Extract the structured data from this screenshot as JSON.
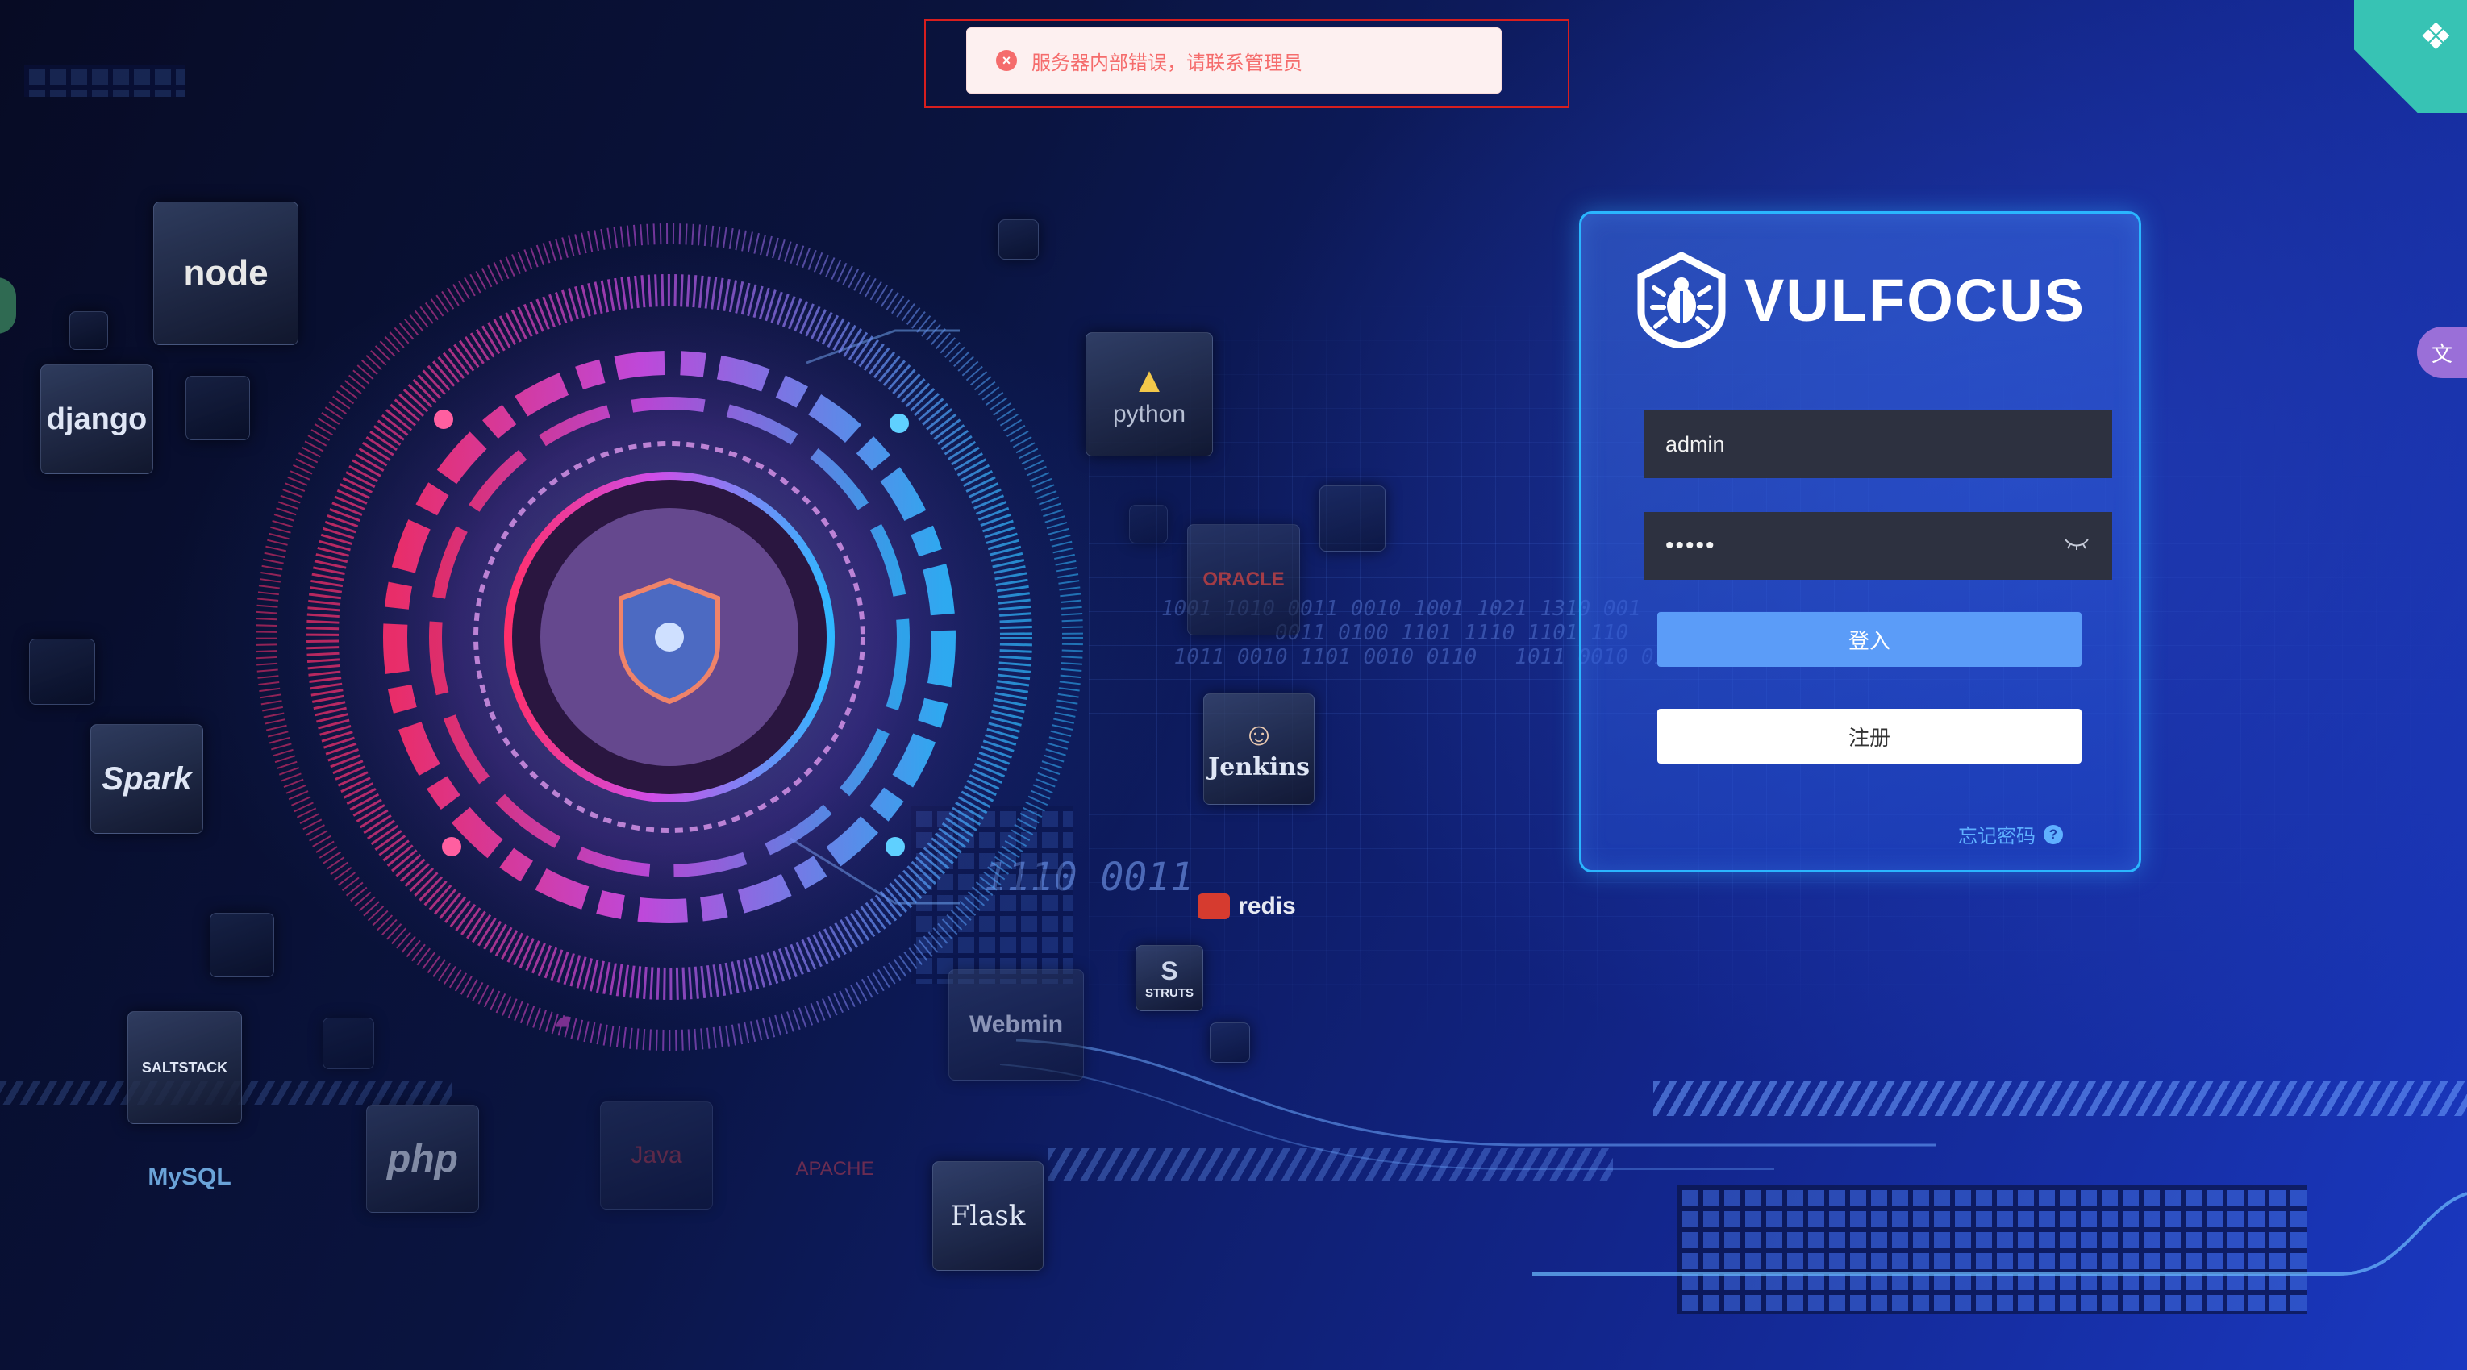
{
  "toast": {
    "icon": "error-circle-icon",
    "message": "服务器内部错误，请联系管理员"
  },
  "login": {
    "brand_name": "VULFOCUS",
    "username_value": "admin",
    "password_value": "•••••",
    "login_label": "登入",
    "register_label": "注册",
    "forgot_label": "忘记密码"
  },
  "tech_logos": {
    "node": "node",
    "django": "django",
    "python": "python",
    "oracle": "ORACLE",
    "jenkins": "Jenkins",
    "redis": "redis",
    "struts": "STRUTS",
    "spark": "Spark",
    "saltstack": "SALTSTACK",
    "mysql": "MySQL",
    "php": "php",
    "java": "Java",
    "apache": "APACHE",
    "webmin": "Webmin",
    "flask": "Flask"
  },
  "colors": {
    "accent": "#5b9cf8",
    "card_border": "#2ab6ff",
    "error": "#f56c6c",
    "ribbon": "#37c3b4"
  }
}
